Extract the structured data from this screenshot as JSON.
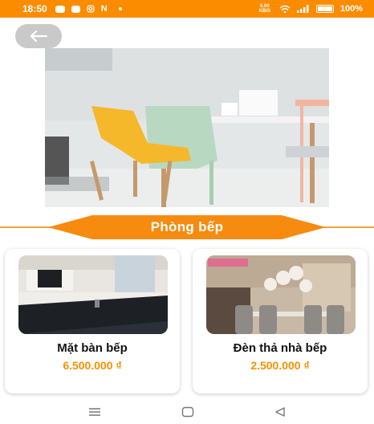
{
  "status_bar": {
    "time": "18:50",
    "notification_icons": [
      "messenger-icon",
      "chat-icon",
      "instagram-icon",
      "n-icon",
      "dot-icon"
    ],
    "network_speed": "5.00 KB/S",
    "battery": "100%"
  },
  "category_title": "Phòng bếp",
  "products": [
    {
      "name": "Mặt bàn bếp",
      "price": "6.500.000 ₫"
    },
    {
      "name": "Đèn thả nhà bếp",
      "price": "2.500.000 ₫"
    }
  ],
  "colors": {
    "accent": "#fb8c00",
    "price": "#f39200"
  },
  "nav_icons": [
    "menu-icon",
    "home-icon",
    "back-triangle-icon"
  ]
}
